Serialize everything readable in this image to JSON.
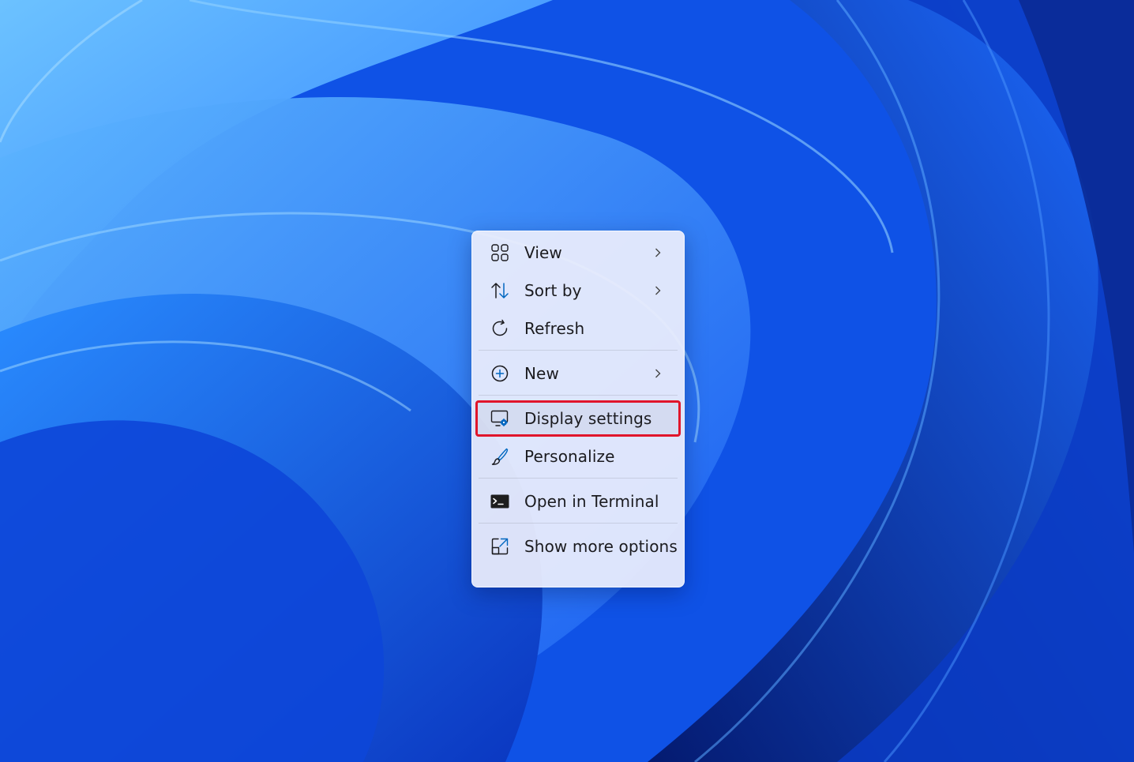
{
  "menu": {
    "items": [
      {
        "label": "View",
        "icon": "grid-view-icon",
        "submenu": true
      },
      {
        "label": "Sort by",
        "icon": "sort-arrows-icon",
        "submenu": true
      },
      {
        "label": "Refresh",
        "icon": "refresh-icon",
        "submenu": false
      },
      {
        "label": "New",
        "icon": "plus-circle-icon",
        "submenu": true
      },
      {
        "label": "Display settings",
        "icon": "display-settings-icon",
        "submenu": false,
        "highlighted": true
      },
      {
        "label": "Personalize",
        "icon": "paintbrush-icon",
        "submenu": false
      },
      {
        "label": "Open in Terminal",
        "icon": "terminal-icon",
        "submenu": false
      },
      {
        "label": "Show more options",
        "icon": "external-window-icon",
        "submenu": false
      }
    ]
  },
  "colors": {
    "highlight_border": "#e0152b",
    "menu_background": "#eceefc",
    "accent_blue": "#0067c0"
  }
}
